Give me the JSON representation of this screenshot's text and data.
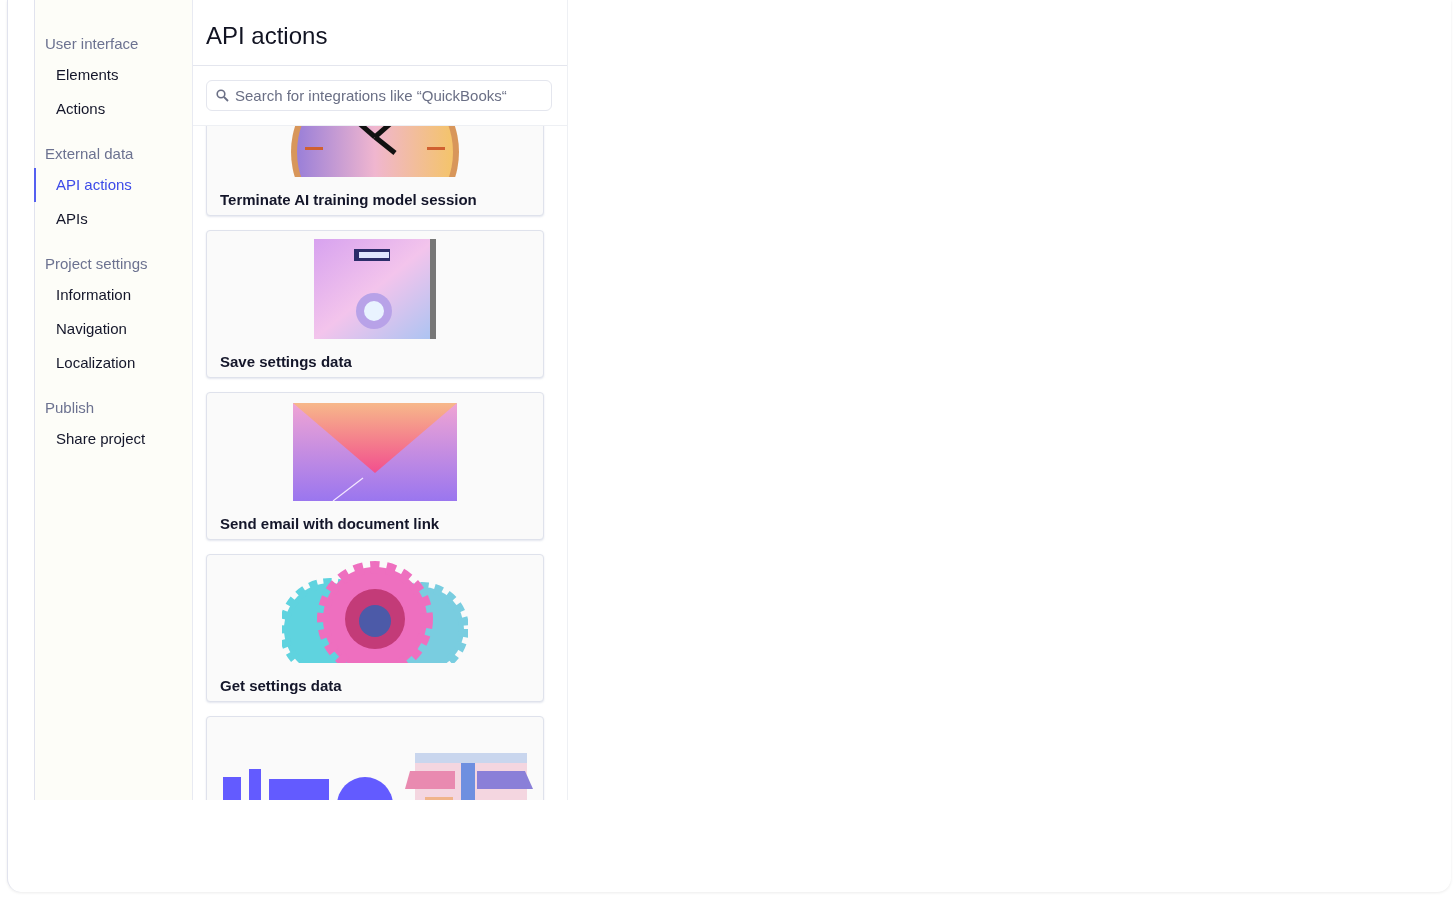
{
  "sidebar": {
    "sections": [
      {
        "heading": "User interface",
        "items": [
          {
            "label": "Elements",
            "selected": false
          },
          {
            "label": "Actions",
            "selected": false
          }
        ]
      },
      {
        "heading": "External data",
        "items": [
          {
            "label": "API actions",
            "selected": true
          },
          {
            "label": "APIs",
            "selected": false
          }
        ]
      },
      {
        "heading": "Project settings",
        "items": [
          {
            "label": "Information",
            "selected": false
          },
          {
            "label": "Navigation",
            "selected": false
          },
          {
            "label": "Localization",
            "selected": false
          }
        ]
      },
      {
        "heading": "Publish",
        "items": [
          {
            "label": "Share project",
            "selected": false
          }
        ]
      }
    ]
  },
  "panel": {
    "title": "API actions",
    "search": {
      "placeholder": "Search for integrations like “QuickBooks“"
    },
    "cards": [
      {
        "title": "Terminate AI training model session",
        "image": {
          "kind": "picture"
        }
      },
      {
        "title": "Save settings data",
        "image": {
          "kind": "picture"
        }
      },
      {
        "title": "Send email with document link",
        "image": {
          "kind": "picture"
        }
      },
      {
        "title": "Get settings data",
        "image": {
          "kind": "picture"
        }
      },
      {
        "image": {
          "kind": "picture"
        }
      }
    ]
  }
}
